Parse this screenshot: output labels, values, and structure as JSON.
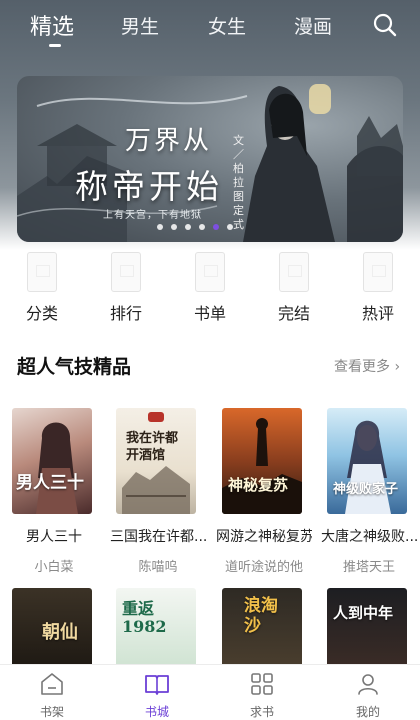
{
  "top_tabs": [
    {
      "label": "精选",
      "active": true
    },
    {
      "label": "男生",
      "active": false
    },
    {
      "label": "女生",
      "active": false
    },
    {
      "label": "漫画",
      "active": false
    }
  ],
  "banner": {
    "title_line1": "万界从",
    "title_line2": "称帝开始",
    "subtitle": "上有天宫，下有地狱",
    "author": "文／柏拉图定式",
    "dots_total": 6,
    "dots_active_index": 4
  },
  "quick_menu": [
    {
      "label": "分类"
    },
    {
      "label": "排行"
    },
    {
      "label": "书单"
    },
    {
      "label": "完结"
    },
    {
      "label": "热评"
    }
  ],
  "section": {
    "title": "超人气技精品",
    "more": "查看更多 ›"
  },
  "books": [
    {
      "title": "男人三十",
      "author": "小白菜",
      "cover_text": "男人三十"
    },
    {
      "title": "三国我在许都...",
      "author": "陈喵呜",
      "cover_text": "我在许都开酒馆"
    },
    {
      "title": "网游之神秘复苏",
      "author": "道听途说的他",
      "cover_text": "神秘复苏"
    },
    {
      "title": "大唐之神级败...",
      "author": "推塔天王",
      "cover_text": "神级败家子"
    }
  ],
  "books_row2": [
    {
      "cover_text": "朝仙"
    },
    {
      "cover_text": "重返1982"
    },
    {
      "cover_text": "浪淘沙"
    },
    {
      "cover_text": "人到中年"
    }
  ],
  "bottom_nav": [
    {
      "label": "书架",
      "icon": "shelf-icon",
      "active": false
    },
    {
      "label": "书城",
      "icon": "book-open-icon",
      "active": true
    },
    {
      "label": "求书",
      "icon": "grid-icon",
      "active": false
    },
    {
      "label": "我的",
      "icon": "user-icon",
      "active": false
    }
  ],
  "colors": {
    "accent": "#6b3fd6",
    "header": "#5b656e"
  }
}
